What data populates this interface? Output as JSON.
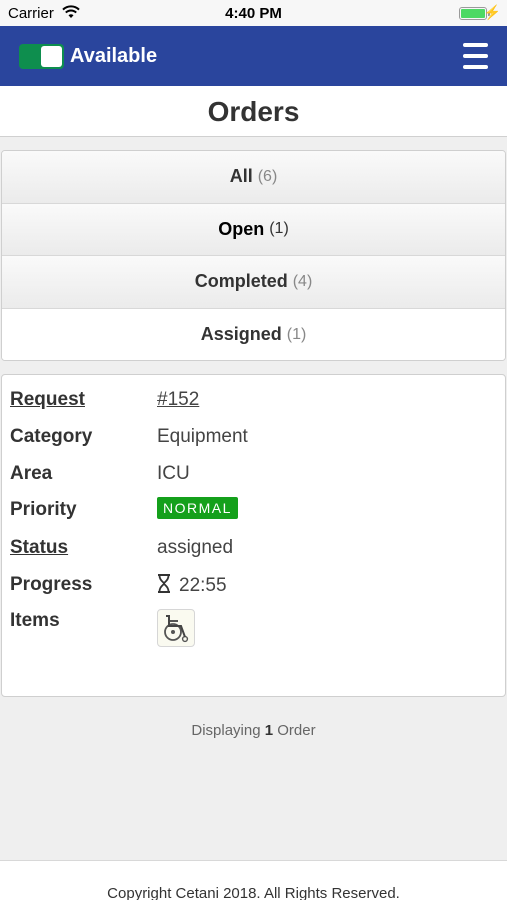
{
  "status_bar": {
    "carrier": "Carrier",
    "time": "4:40 PM"
  },
  "nav": {
    "availability_label": "Available",
    "availability_on": true
  },
  "page": {
    "title": "Orders"
  },
  "filters": [
    {
      "label": "All",
      "count": "(6)"
    },
    {
      "label": "Open",
      "count": "(1)"
    },
    {
      "label": "Completed",
      "count": "(4)"
    },
    {
      "label": "Assigned",
      "count": "(1)"
    }
  ],
  "order": {
    "request_label": "Request",
    "request_value": "#152",
    "category_label": "Category",
    "category_value": "Equipment",
    "area_label": "Area",
    "area_value": "ICU",
    "priority_label": "Priority",
    "priority_value": "NORMAL",
    "status_label": "Status",
    "status_value": "assigned",
    "progress_label": "Progress",
    "progress_value": "22:55",
    "items_label": "Items",
    "items_icon": "wheelchair-icon"
  },
  "summary": {
    "prefix": "Displaying",
    "count": "1",
    "suffix": "Order"
  },
  "footer": {
    "copyright": "Copyright Cetani 2018. All Rights Reserved."
  },
  "colors": {
    "nav_bg": "#2a459d",
    "toggle_on": "#0e8e4e",
    "priority_badge": "#14a01b"
  }
}
